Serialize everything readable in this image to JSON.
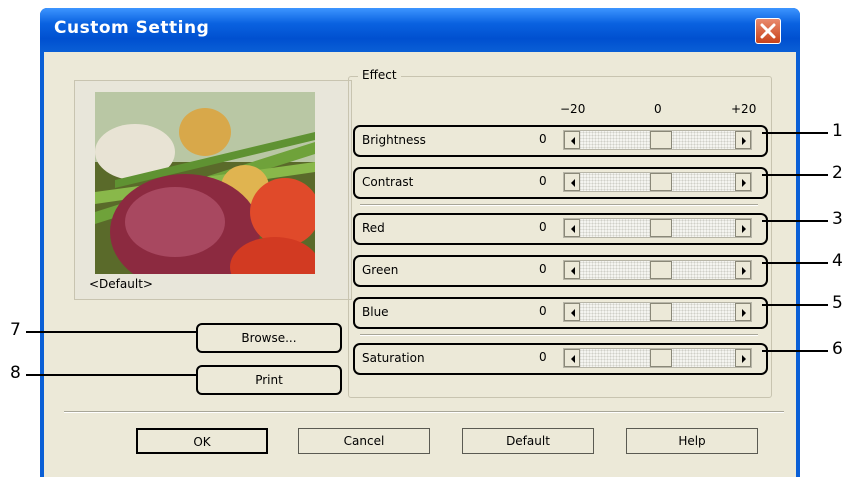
{
  "window": {
    "title": "Custom Setting",
    "close_icon": "close-icon"
  },
  "preview": {
    "caption": "<Default>"
  },
  "effect": {
    "group_title": "Effect",
    "scale": {
      "min": "−20",
      "mid": "0",
      "max": "+20"
    },
    "sliders": [
      {
        "label": "Brightness",
        "value": "0",
        "position": 0
      },
      {
        "label": "Contrast",
        "value": "0",
        "position": 0
      },
      {
        "label": "Red",
        "value": "0",
        "position": 0
      },
      {
        "label": "Green",
        "value": "0",
        "position": 0
      },
      {
        "label": "Blue",
        "value": "0",
        "position": 0
      },
      {
        "label": "Saturation",
        "value": "0",
        "position": 0
      }
    ]
  },
  "buttons": {
    "browse": "Browse...",
    "print": "Print",
    "ok": "OK",
    "cancel": "Cancel",
    "default": "Default",
    "help": "Help"
  },
  "callouts": [
    "1",
    "2",
    "3",
    "4",
    "5",
    "6",
    "7",
    "8"
  ],
  "colors": {
    "titlebar": "#0a5fd6",
    "dialog_bg": "#ece9d8",
    "close": "#c8421b"
  }
}
